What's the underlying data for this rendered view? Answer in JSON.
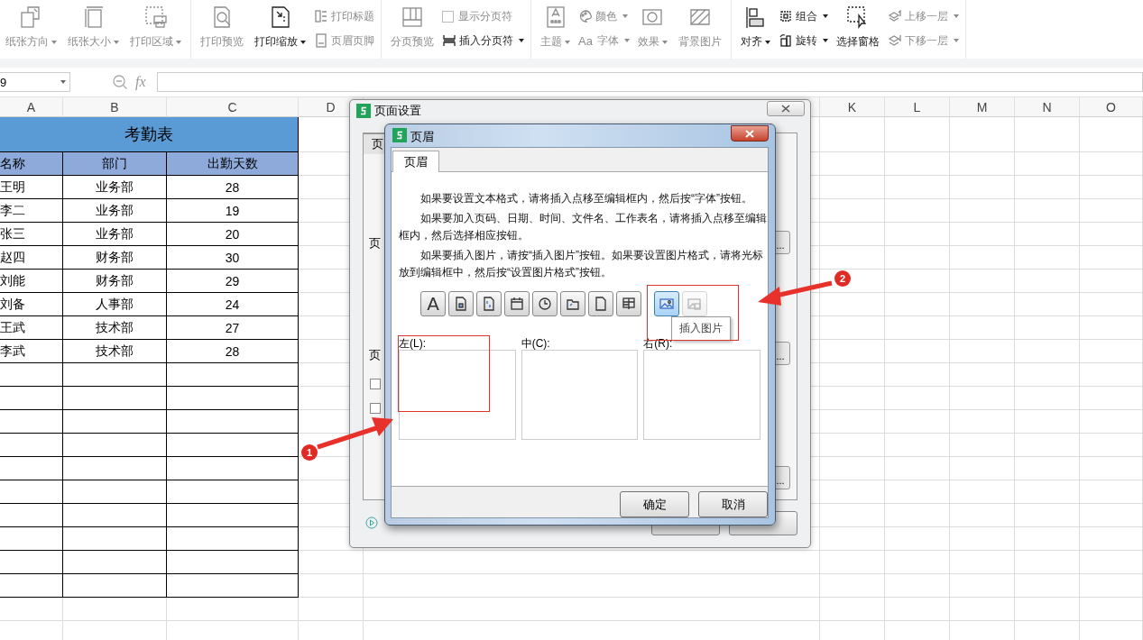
{
  "ribbon": {
    "groups": [
      {
        "columns": [
          {
            "kind": "large",
            "label": "纸张方向",
            "dropdown": true,
            "disabled": true
          },
          {
            "kind": "large",
            "label": "纸张大小",
            "dropdown": true,
            "disabled": true
          },
          {
            "kind": "large",
            "label": "打印区域",
            "dropdown": true,
            "disabled": true
          }
        ]
      },
      {
        "columns": [
          {
            "kind": "large",
            "label": "打印预览",
            "dropdown": false,
            "disabled": true
          },
          {
            "kind": "large",
            "label": "打印缩放",
            "dropdown": true,
            "disabled": false
          },
          {
            "kind": "stack",
            "items": [
              {
                "kind": "button",
                "label": "打印标题",
                "dropdown": false,
                "disabled": true
              },
              {
                "kind": "button",
                "label": "页眉页脚",
                "dropdown": false,
                "disabled": true
              }
            ]
          }
        ]
      },
      {
        "columns": [
          {
            "kind": "large",
            "label": "分页预览",
            "dropdown": false,
            "disabled": true
          },
          {
            "kind": "stack",
            "items": [
              {
                "kind": "check",
                "label": "显示分页符",
                "checked": false,
                "disabled": true
              },
              {
                "kind": "button",
                "label": "插入分页符",
                "dropdown": true,
                "disabled": false
              }
            ]
          }
        ]
      },
      {
        "columns": [
          {
            "kind": "large",
            "label": "主题",
            "dropdown": true,
            "disabled": true
          },
          {
            "kind": "stack",
            "items": [
              {
                "kind": "button",
                "label": "颜色",
                "dropdown": true,
                "disabled": true
              },
              {
                "kind": "font",
                "icon_text": "Aa",
                "label": "字体",
                "dropdown": true,
                "disabled": true
              }
            ]
          },
          {
            "kind": "large",
            "label": "效果",
            "dropdown": true,
            "disabled": true
          },
          {
            "kind": "large",
            "label": "背景图片",
            "dropdown": false,
            "disabled": true
          }
        ]
      },
      {
        "columns": [
          {
            "kind": "large",
            "label": "对齐",
            "dropdown": true,
            "disabled": false
          },
          {
            "kind": "stack",
            "items": [
              {
                "kind": "button",
                "label": "组合",
                "dropdown": true,
                "disabled": false
              },
              {
                "kind": "button",
                "label": "旋转",
                "dropdown": true,
                "disabled": false
              }
            ]
          },
          {
            "kind": "large",
            "label": "选择窗格",
            "dropdown": false,
            "disabled": false
          },
          {
            "kind": "stack",
            "items": [
              {
                "kind": "button",
                "label": "上移一层",
                "dropdown": true,
                "disabled": true
              },
              {
                "kind": "button",
                "label": "下移一层",
                "dropdown": true,
                "disabled": true
              }
            ]
          }
        ]
      }
    ]
  },
  "formula_bar": {
    "name_box": "9",
    "fx_label": "fx"
  },
  "sheet": {
    "columns_left": [
      "A",
      "B",
      "C",
      "D"
    ],
    "columns_right": [
      "K",
      "L",
      "M",
      "N",
      "O"
    ]
  },
  "table": {
    "title": "考勤表",
    "headers": [
      "名称",
      "部门",
      "出勤天数"
    ],
    "rows": [
      [
        "王明",
        "业务部",
        "28"
      ],
      [
        "李二",
        "业务部",
        "19"
      ],
      [
        "张三",
        "业务部",
        "20"
      ],
      [
        "赵四",
        "财务部",
        "30"
      ],
      [
        "刘能",
        "财务部",
        "29"
      ],
      [
        "刘备",
        "人事部",
        "24"
      ],
      [
        "王武",
        "技术部",
        "27"
      ],
      [
        "李武",
        "技术部",
        "28"
      ]
    ]
  },
  "page_setup_dialog": {
    "title": "页面设置",
    "tab": "页",
    "section_labels": [
      "页",
      "页"
    ],
    "checkboxes": [
      {
        "checked": false
      },
      {
        "checked": false
      }
    ],
    "browse_buttons": [
      "...",
      "...",
      "..."
    ]
  },
  "header_dialog": {
    "title": "页眉",
    "tabs": [
      {
        "label": "页眉",
        "selected": true
      }
    ],
    "instructions": [
      "如果要设置文本格式，请将插入点移至编辑框内，然后按“字体”按钮。",
      "如果要加入页码、日期、时间、文件名、工作表名，请将插入点移至编辑框内，然后选择相应按钮。",
      "如果要插入图片，请按“插入图片”按钮。如果要设置图片格式，请将光标放到编辑框中，然后按“设置图片格式”按钮。"
    ],
    "tool_buttons": [
      {
        "glyph": "A",
        "selected": false,
        "disabled": false
      },
      {
        "selected": false,
        "disabled": false
      },
      {
        "selected": false,
        "disabled": false
      },
      {
        "selected": false,
        "disabled": false
      },
      {
        "selected": false,
        "disabled": false
      },
      {
        "selected": false,
        "disabled": false
      },
      {
        "selected": false,
        "disabled": false
      },
      {
        "selected": false,
        "disabled": false
      },
      {
        "selected": true,
        "disabled": false
      },
      {
        "selected": false,
        "disabled": true
      }
    ],
    "tooltip": "插入图片",
    "sections": [
      {
        "label": "左(L):"
      },
      {
        "label": "中(C):"
      },
      {
        "label": "右(R):"
      }
    ],
    "buttons": [
      "确定",
      "取消"
    ]
  },
  "annotations": [
    {
      "number": "1"
    },
    {
      "number": "2"
    }
  ]
}
